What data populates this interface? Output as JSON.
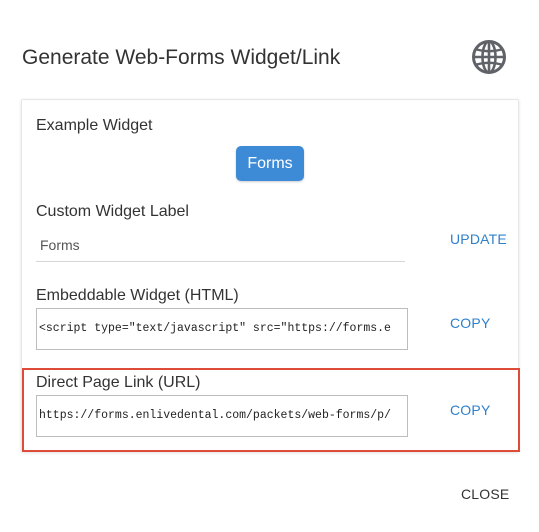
{
  "dialog": {
    "title": "Generate Web-Forms Widget/Link",
    "icon": "globe-icon",
    "close_label": "CLOSE"
  },
  "example_widget": {
    "label": "Example Widget",
    "button_label": "Forms",
    "button_color": "#3d8bd6"
  },
  "custom_label": {
    "label": "Custom Widget Label",
    "value": "Forms",
    "update_label": "UPDATE"
  },
  "embeddable": {
    "label": "Embeddable Widget (HTML)",
    "code": "<script type=\"text/javascript\" src=\"https://forms.e",
    "copy_label": "COPY"
  },
  "direct_link": {
    "label": "Direct Page Link (URL)",
    "url": "https://forms.enlivedental.com/packets/web-forms/p/",
    "copy_label": "COPY",
    "highlight_color": "#dd4b39"
  },
  "colors": {
    "accent": "#2f80c9"
  }
}
